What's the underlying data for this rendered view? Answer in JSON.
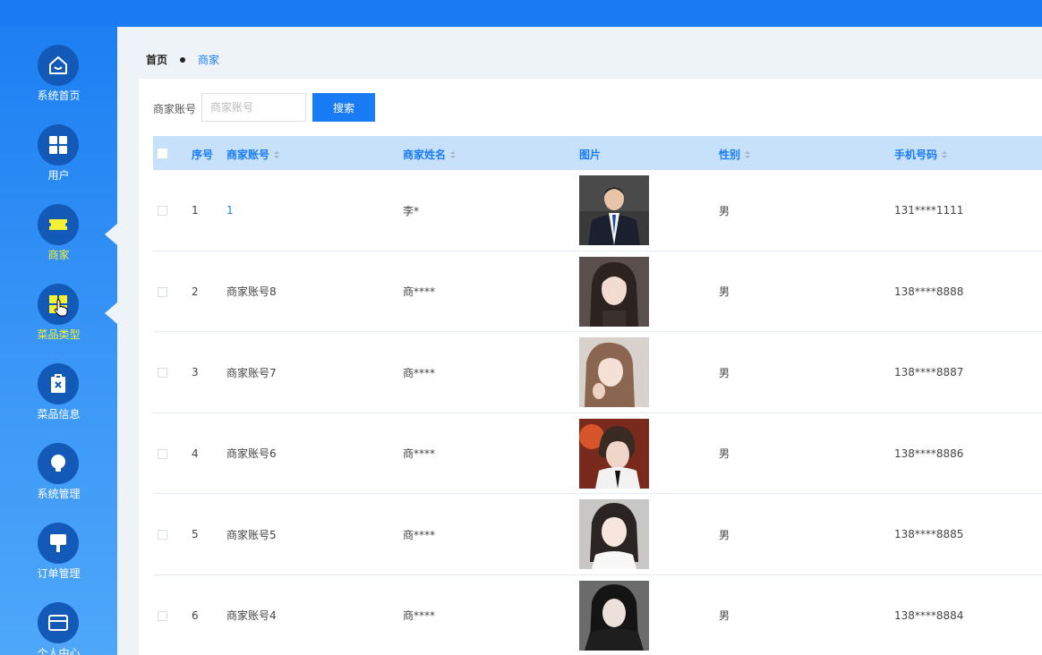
{
  "sidebar": {
    "items": [
      {
        "label": "系统首页",
        "icon": "home-icon"
      },
      {
        "label": "用户",
        "icon": "grid-icon"
      },
      {
        "label": "商家",
        "icon": "ticket-icon"
      },
      {
        "label": "菜品类型",
        "icon": "category-icon"
      },
      {
        "label": "菜品信息",
        "icon": "clipboard-x-icon"
      },
      {
        "label": "系统管理",
        "icon": "lightbulb-icon"
      },
      {
        "label": "订单管理",
        "icon": "brush-icon"
      },
      {
        "label": "个人中心",
        "icon": "card-icon"
      }
    ]
  },
  "breadcrumb": {
    "home": "首页",
    "current": "商家"
  },
  "search": {
    "label": "商家账号",
    "placeholder": "商家账号",
    "button": "搜索"
  },
  "table": {
    "headers": {
      "index": "序号",
      "account": "商家账号",
      "name": "商家姓名",
      "image": "图片",
      "gender": "性别",
      "phone": "手机号码"
    },
    "rows": [
      {
        "index": "1",
        "account": "1",
        "name": "李*",
        "gender": "男",
        "phone": "131****1111"
      },
      {
        "index": "2",
        "account": "商家账号8",
        "name": "商****",
        "gender": "男",
        "phone": "138****8888"
      },
      {
        "index": "3",
        "account": "商家账号7",
        "name": "商****",
        "gender": "男",
        "phone": "138****8887"
      },
      {
        "index": "4",
        "account": "商家账号6",
        "name": "商****",
        "gender": "男",
        "phone": "138****8886"
      },
      {
        "index": "5",
        "account": "商家账号5",
        "name": "商****",
        "gender": "男",
        "phone": "138****8885"
      },
      {
        "index": "6",
        "account": "商家账号4",
        "name": "商****",
        "gender": "男",
        "phone": "138****8884"
      }
    ]
  },
  "colors": {
    "accent": "#1a7cf5",
    "active_nav": "#f4f033",
    "header_bg": "#c7e1fb"
  }
}
